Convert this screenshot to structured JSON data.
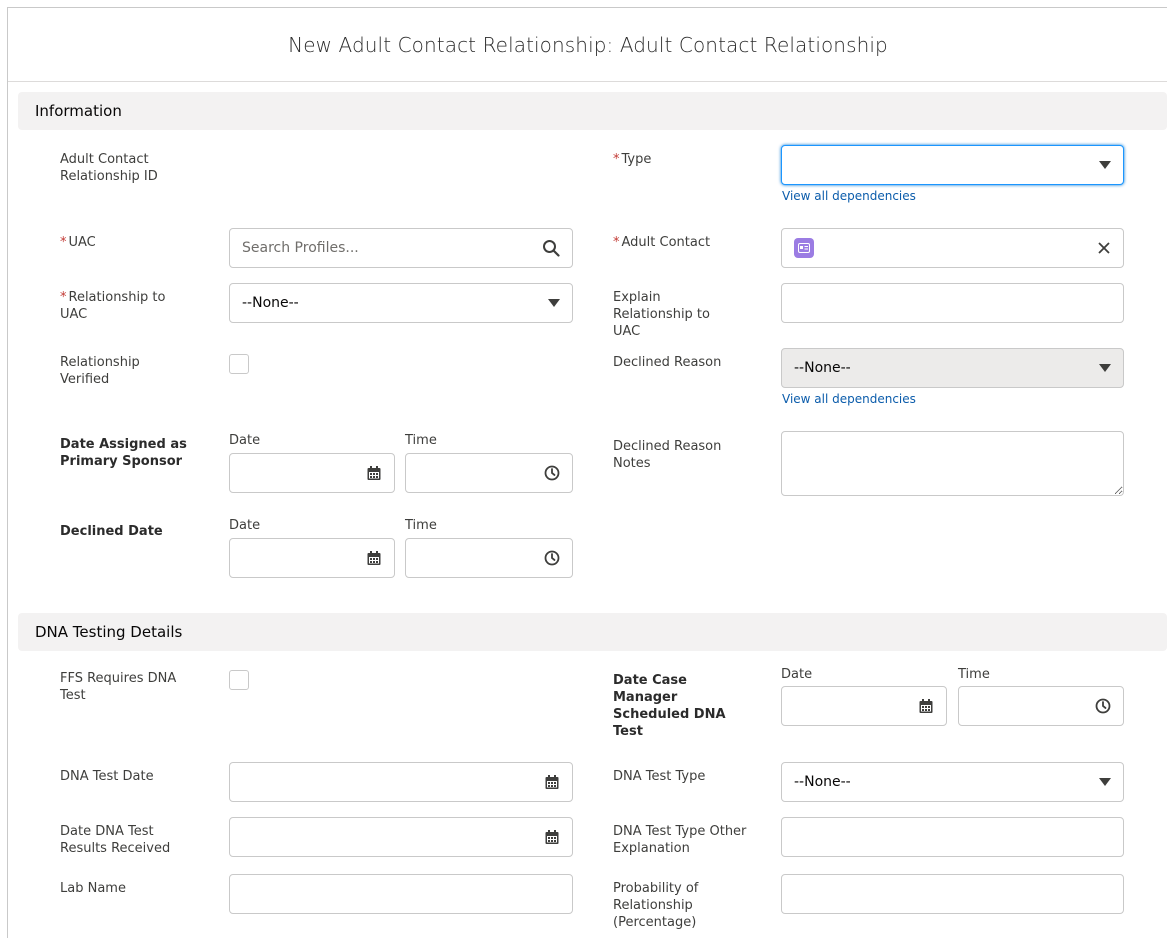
{
  "header": {
    "title": "New Adult Contact Relationship: Adult Contact Relationship"
  },
  "sections": {
    "information": "Information",
    "dna": "DNA Testing Details"
  },
  "info": {
    "adult_contact_relationship_id_label": "Adult Contact Relationship ID",
    "type_label": "Type",
    "type_value": "",
    "view_all_dependencies": "View all dependencies",
    "uac_label": "UAC",
    "uac_placeholder": "Search Profiles...",
    "adult_contact_label": "Adult Contact",
    "relationship_to_uac_label": "Relationship to UAC",
    "relationship_to_uac_value": "--None--",
    "explain_relationship_label": "Explain Relationship to UAC",
    "relationship_verified_label": "Relationship Verified",
    "declined_reason_label": "Declined Reason",
    "declined_reason_value": "--None--",
    "date_assigned_label": "Date Assigned as Primary Sponsor",
    "date_label": "Date",
    "time_label": "Time",
    "declined_reason_notes_label": "Declined Reason Notes",
    "declined_date_label": "Declined Date"
  },
  "dna": {
    "ffs_requires_label": "FFS Requires DNA Test",
    "date_case_manager_label": "Date Case Manager Scheduled DNA Test",
    "date_label": "Date",
    "time_label": "Time",
    "dna_test_date_label": "DNA Test Date",
    "dna_test_type_label": "DNA Test Type",
    "dna_test_type_value": "--None--",
    "date_results_label": "Date DNA Test Results Received",
    "dna_test_type_other_label": "DNA Test Type Other Explanation",
    "lab_name_label": "Lab Name",
    "probability_label": "Probability of Relationship (Percentage)"
  },
  "icons": {
    "search": "search-icon",
    "calendar": "calendar-icon",
    "clock": "clock-icon",
    "clear": "close-icon",
    "contact": "contact-card-icon",
    "dropdown": "chevron-down-icon"
  },
  "colors": {
    "required": "#c23934",
    "link": "#0b5cab",
    "focus_border": "#1b96ff",
    "contact_badge": "#9b7ce3"
  }
}
